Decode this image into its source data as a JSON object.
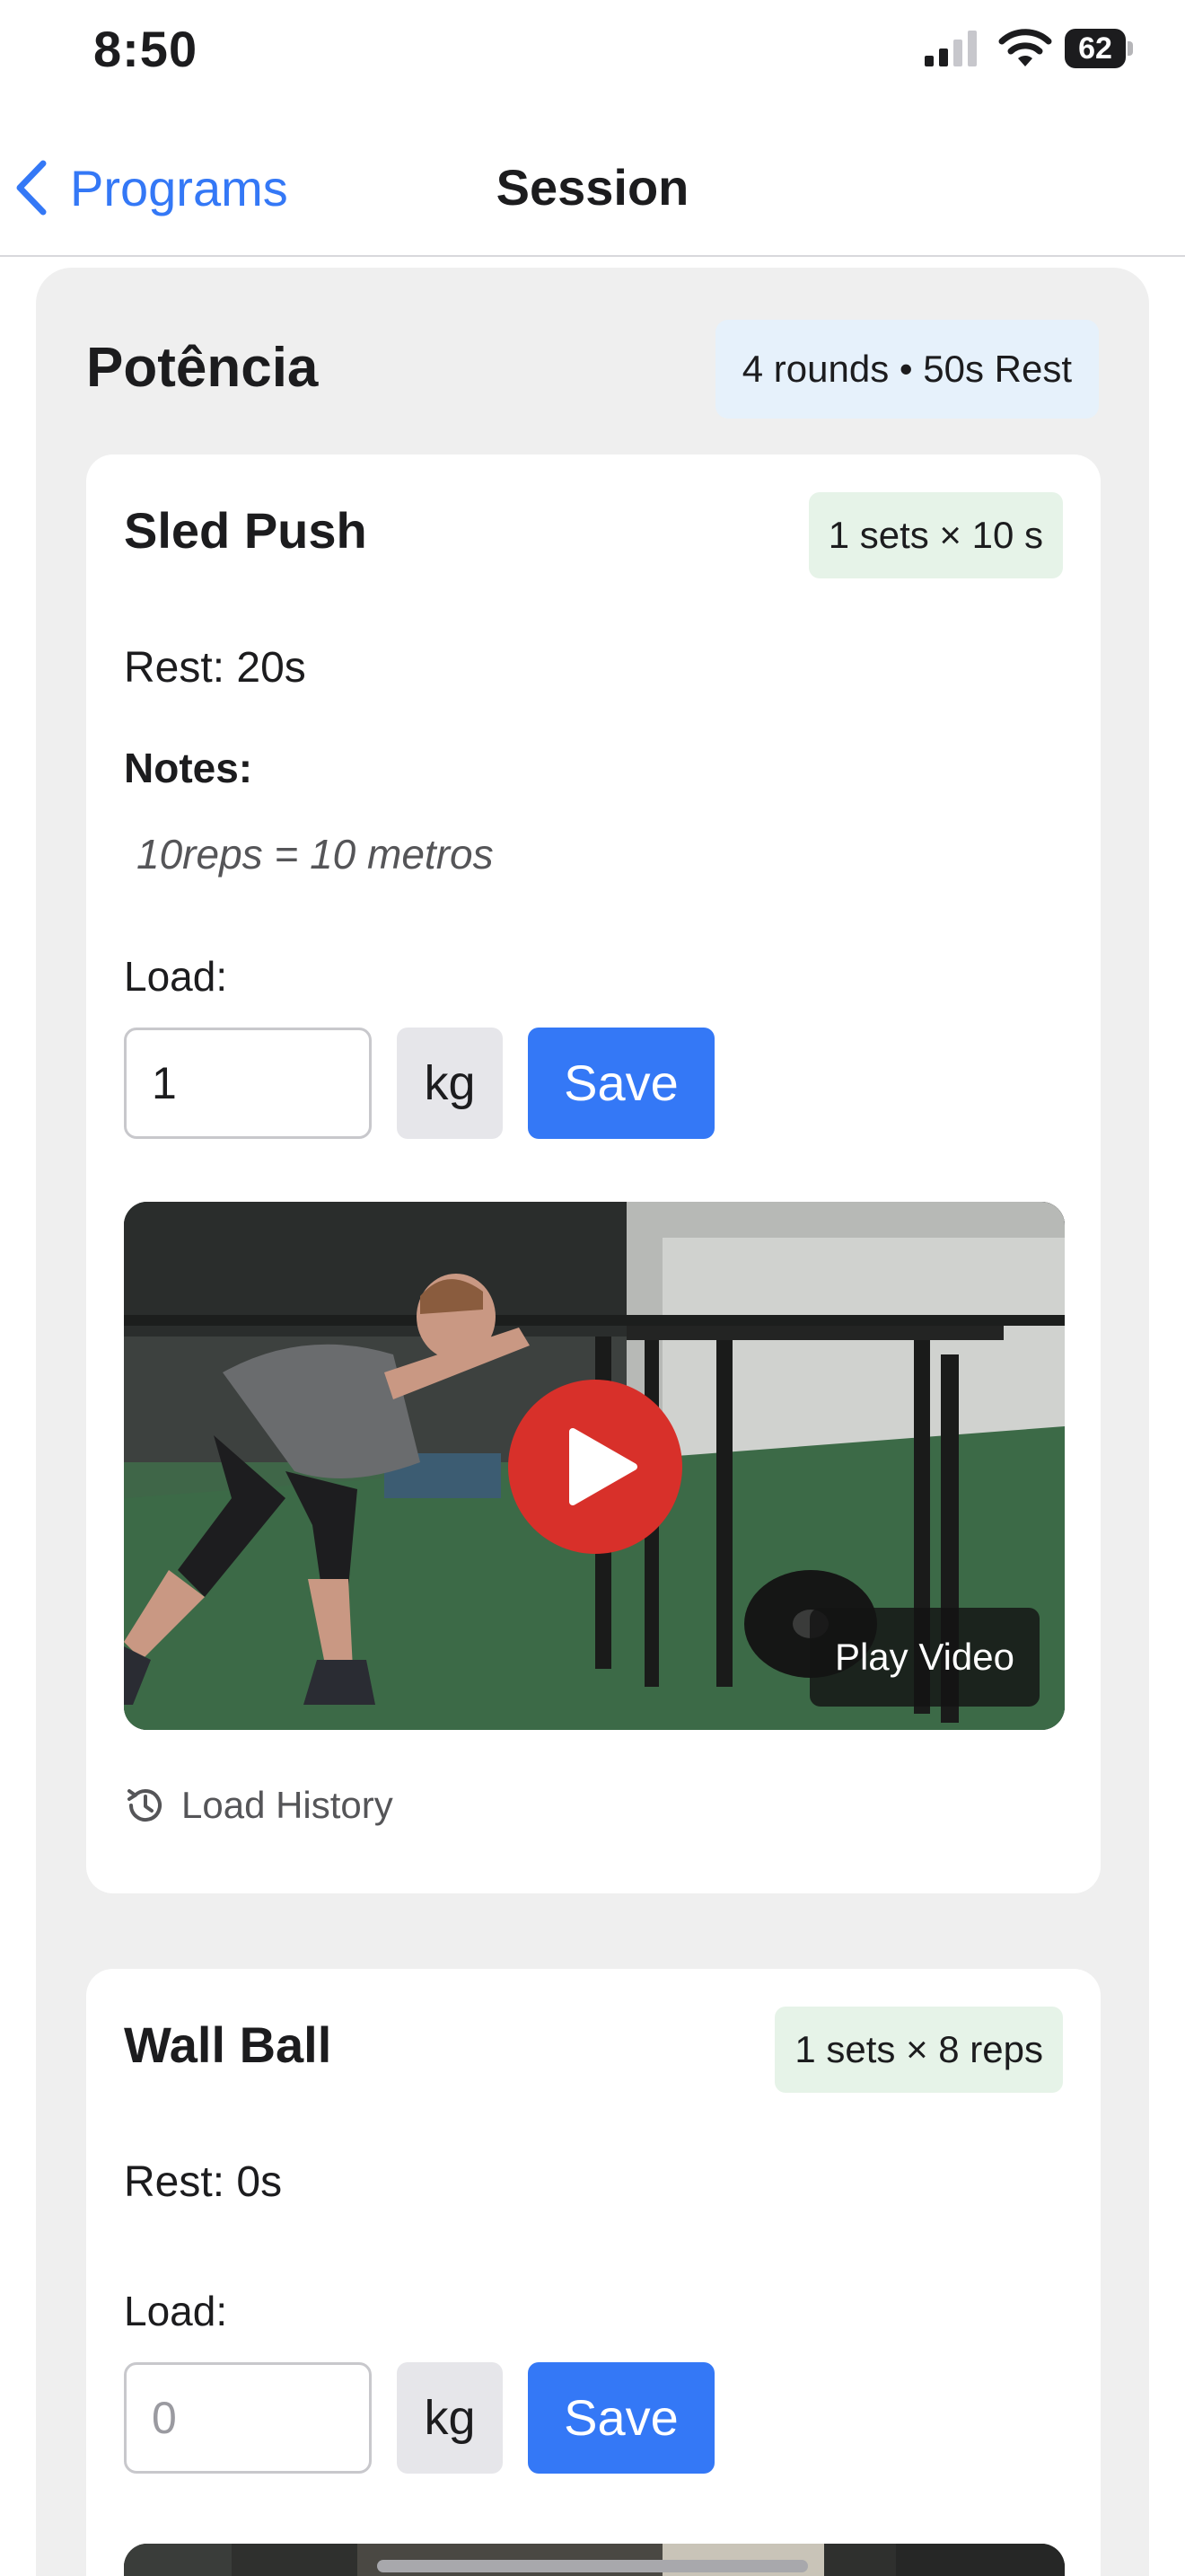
{
  "status_bar": {
    "time": "8:50",
    "battery_level": "62"
  },
  "nav": {
    "back_label": "Programs",
    "title": "Session"
  },
  "block": {
    "title": "Potência",
    "rounds_badge": "4 rounds • 50s Rest"
  },
  "exercises": [
    {
      "name": "Sled Push",
      "sets_badge": "1 sets × 10 s",
      "rest": "Rest: 20s",
      "notes_label": "Notes:",
      "notes": "10reps = 10 metros",
      "load_label": "Load:",
      "load_value": "1",
      "load_placeholder": "",
      "unit": "kg",
      "save_label": "Save",
      "video_label": "Play Video",
      "history_label": "Load History"
    },
    {
      "name": "Wall Ball",
      "sets_badge": "1 sets × 8 reps",
      "rest": "Rest: 0s",
      "load_label": "Load:",
      "load_value": "",
      "load_placeholder": "0",
      "unit": "kg",
      "save_label": "Save"
    }
  ],
  "colors": {
    "accent": "#3478f6",
    "play_button": "#d8302a",
    "rounds_badge_bg": "#e6f1fb",
    "sets_badge_bg": "#e6f3e8",
    "block_bg": "#efefef"
  },
  "icons": [
    "cellular-signal-icon",
    "wifi-icon",
    "battery-icon",
    "chevron-left-icon",
    "play-icon",
    "history-icon"
  ]
}
